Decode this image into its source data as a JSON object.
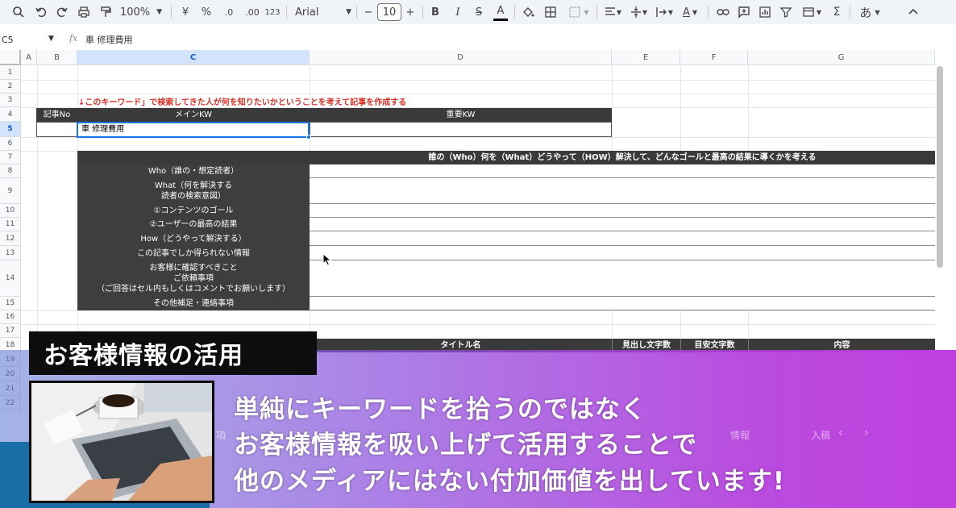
{
  "toolbar": {
    "zoom": "100%",
    "currency": "¥",
    "percent": "%",
    "dec_decrease": ".0",
    "dec_increase": ".00",
    "number_format": "123",
    "font": "Arial",
    "font_size": "10",
    "minus": "−",
    "plus": "+",
    "bold": "B",
    "italic": "I",
    "strike": "S",
    "text_color": "A",
    "input_mode": "あ"
  },
  "formula_bar": {
    "cell_ref": "C5",
    "fx": "fx",
    "value": "車 修理費用"
  },
  "columns": [
    "A",
    "B",
    "C",
    "D",
    "E",
    "F",
    "G"
  ],
  "rows": [
    "1",
    "2",
    "3",
    "4",
    "5",
    "6",
    "7",
    "8",
    "9",
    "10",
    "11",
    "12",
    "13",
    "14",
    "15",
    "16",
    "17",
    "18",
    "19",
    "20",
    "21",
    "22"
  ],
  "sheet": {
    "instruction": "↓このキーワード」で検索してきた人が何を知りたいかということを考えて記事を作成する",
    "header_article_no": "記事No",
    "header_main_kw": "メインKW",
    "header_important_kw": "重要KW",
    "c5_value": "車 修理費用",
    "planning_header": "誰の（Who）何を（What）どうやって（HOW）解決して、どんなゴールと最高の結果に導くかを考える",
    "planning_rows": [
      "Who（誰の・想定読者）",
      "What（何を解決する\n読者の検索意図）",
      "①コンテンツのゴール",
      "②ユーザーの最高の結果",
      "How（どうやって解決する）",
      "この記事でしか得られない情報",
      "お客様に確認すべきこと\nご依頼事項\n（ご回答はセル内もしくはコメントでお願いします）",
      "その他補足・連絡事項"
    ],
    "table2_headers": {
      "title": "タイトル名",
      "heading_chars": "見出し文字数",
      "target_chars": "目安文字数",
      "content": "内容"
    }
  },
  "overlay": {
    "banner": "お客様情報の活用",
    "line1": "単純にキーワードを拾うのではなく",
    "line2": "お客様情報を吸い上げて活用することで",
    "line3": "他のメディアにはない付加価値を出しています!",
    "dim_left": "項",
    "dim_mid": "情報",
    "dim_right": "入稿"
  }
}
